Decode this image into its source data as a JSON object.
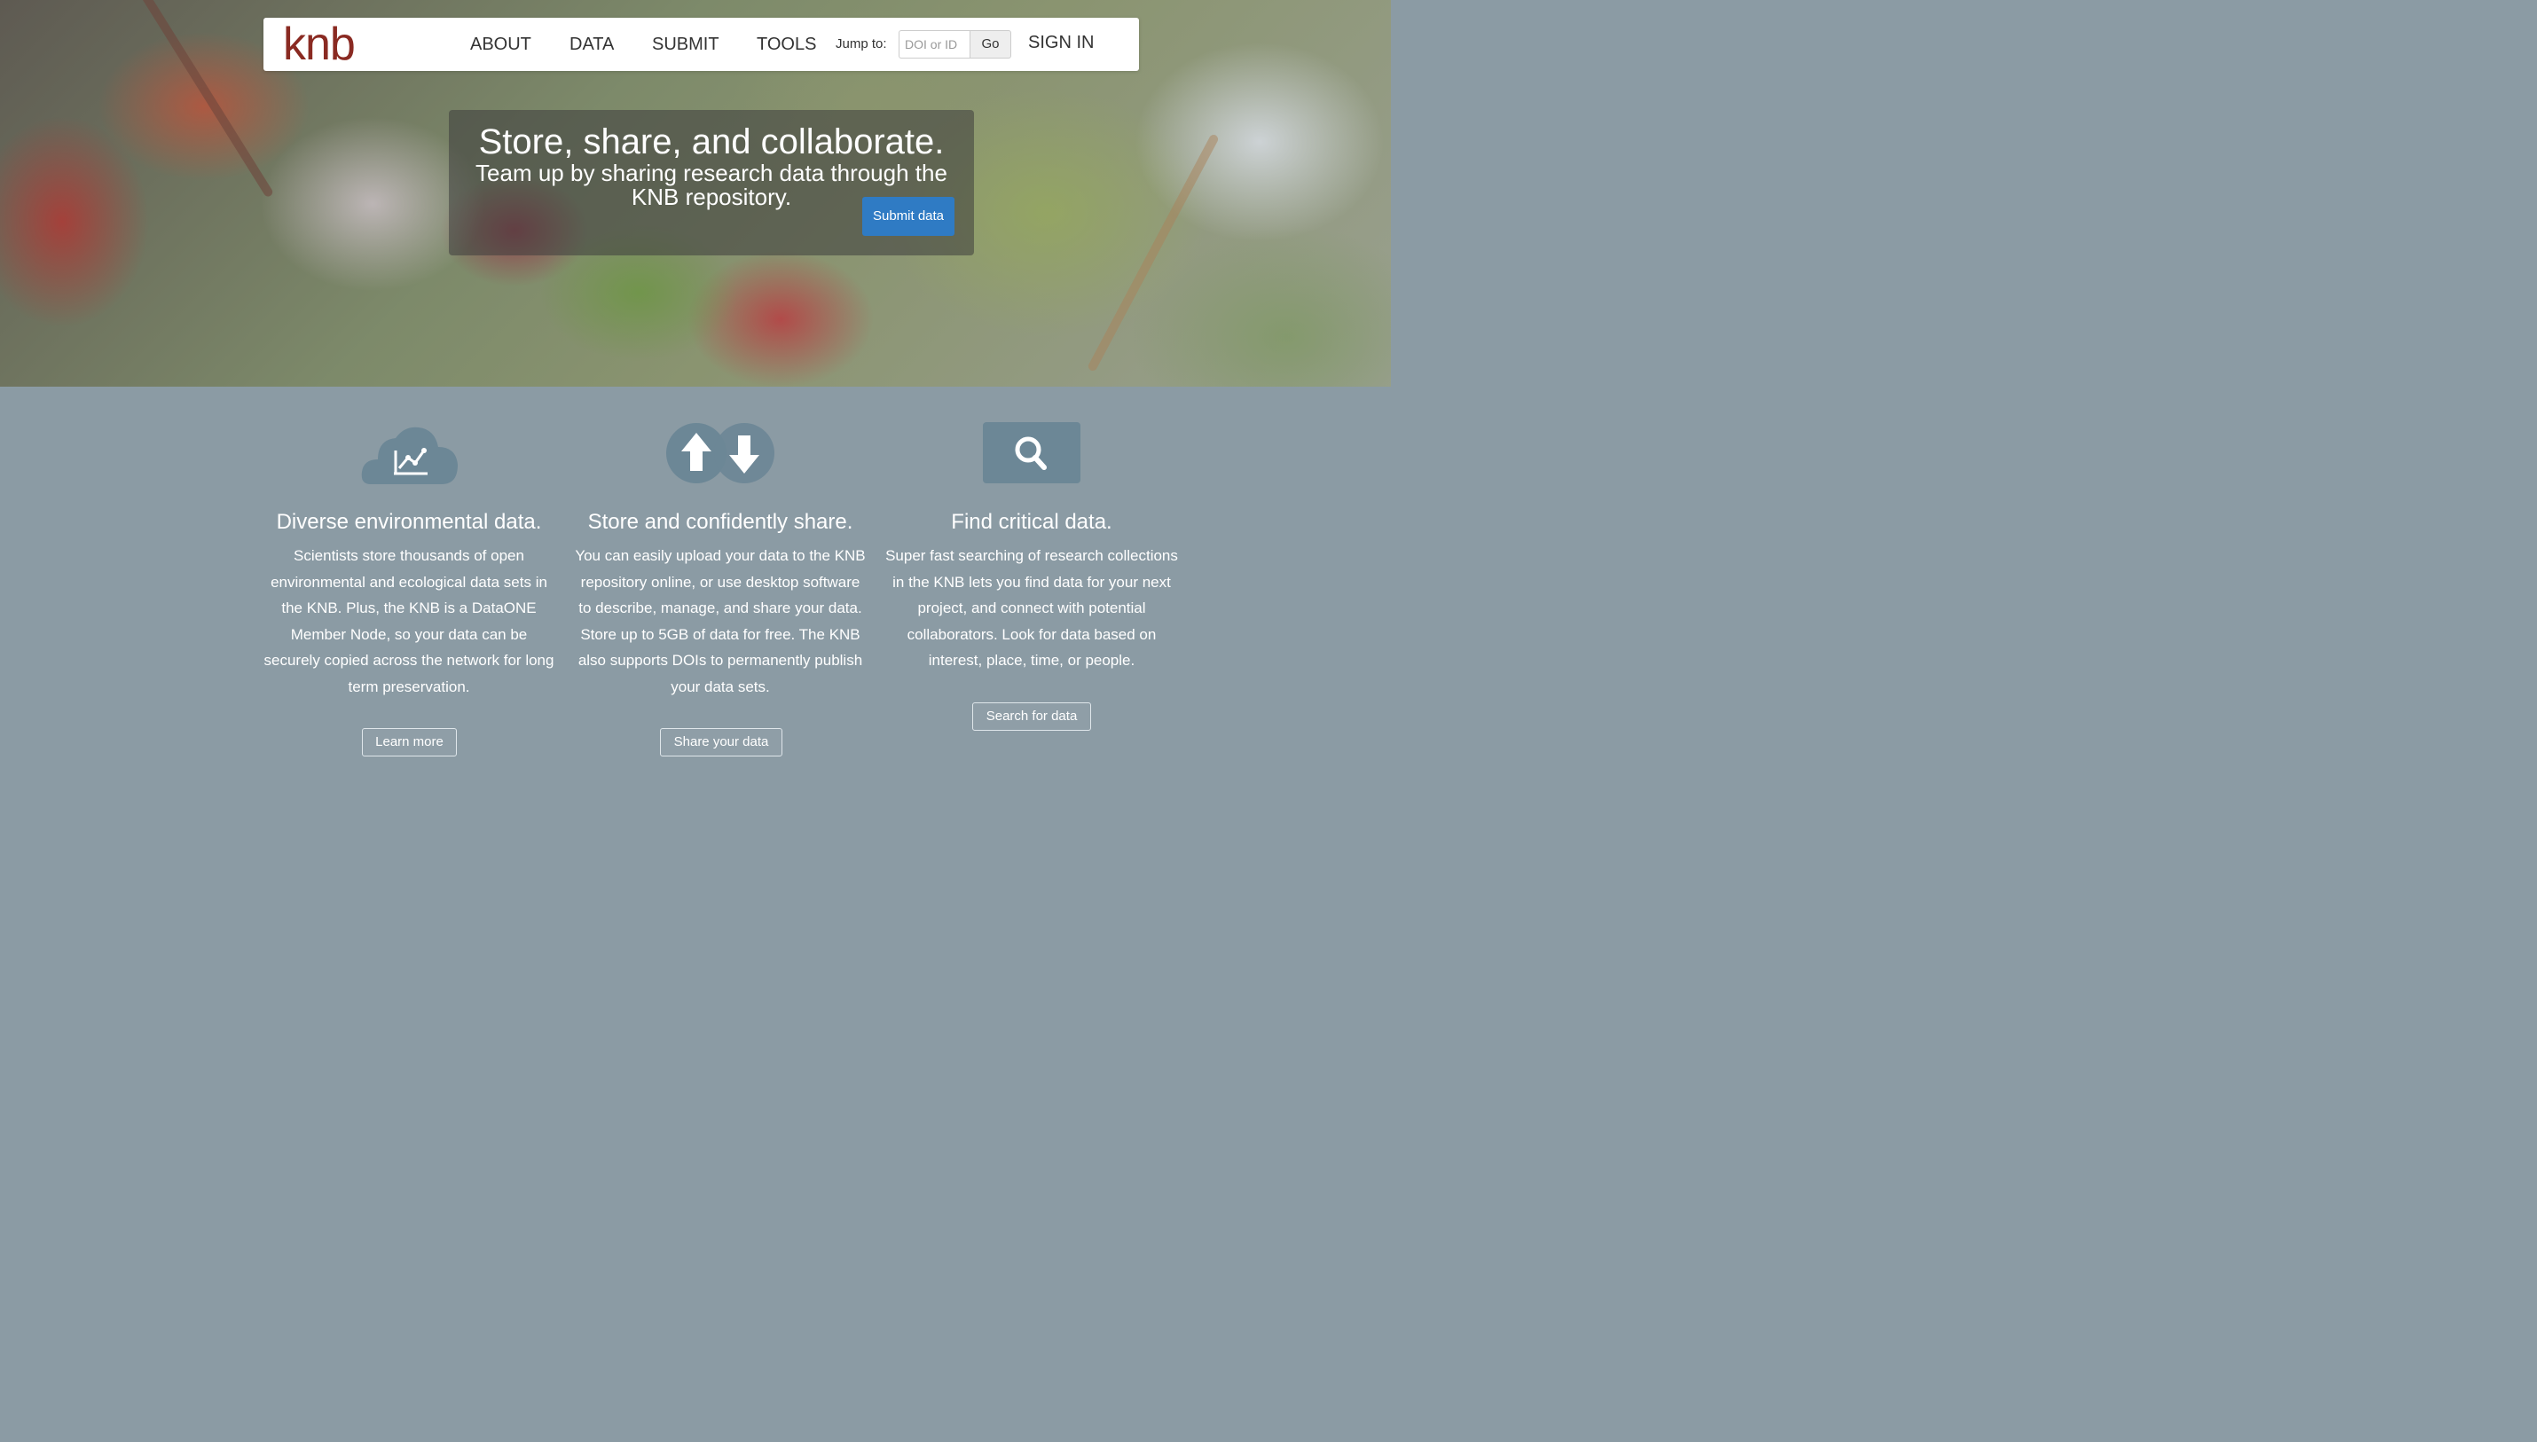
{
  "navbar": {
    "logo": "knb",
    "links": [
      "ABOUT",
      "DATA",
      "SUBMIT",
      "TOOLS"
    ],
    "jump_label": "Jump to:",
    "jump_placeholder": "DOI or ID",
    "go_label": "Go",
    "signin_label": "SIGN IN"
  },
  "hero": {
    "title": "Store, share, and collaborate.",
    "subtitle": "Team up by sharing research data through the KNB repository.",
    "button": "Submit data"
  },
  "features": [
    {
      "icon": "cloud-chart-icon",
      "heading": "Diverse environmental data.",
      "text": "Scientists store thousands of open environmental and ecological data sets in the KNB. Plus, the KNB is a DataONE Member Node, so your data can be securely copied across the network for long term preservation.",
      "button": "Learn more"
    },
    {
      "icon": "upload-download-icon",
      "heading": "Store and confidently share.",
      "text": "You can easily upload your data to the KNB repository online, or use desktop software to describe, manage, and share your data. Store up to 5GB of data for free. The KNB also supports DOIs to permanently publish your data sets.",
      "button": "Share your data"
    },
    {
      "icon": "search-icon",
      "heading": "Find critical data.",
      "text": "Super fast searching of research collections in the KNB lets you find data for your next project, and connect with potential collaborators. Look for data based on interest, place, time, or people.",
      "button": "Search for data"
    }
  ],
  "colors": {
    "brand": "#8a2a22",
    "primary_button": "#2f7bc4",
    "feature_background": "#8b9ba4",
    "icon_fill": "#6c8796"
  }
}
